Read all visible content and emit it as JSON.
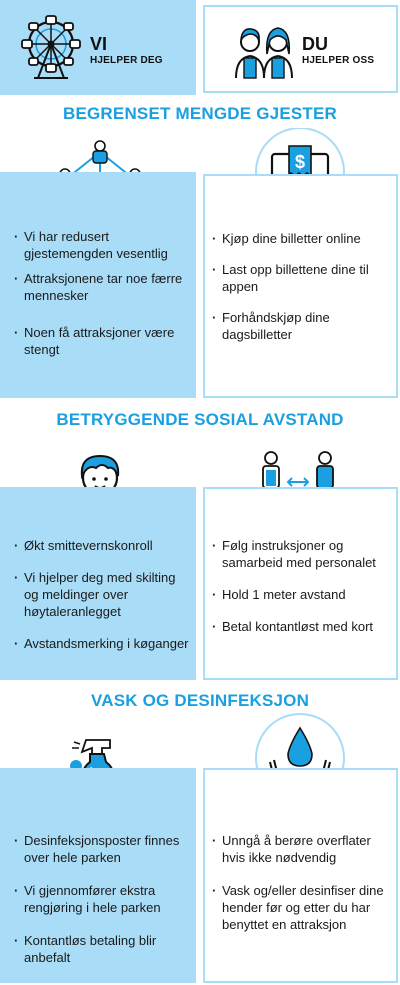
{
  "top": {
    "left": {
      "title": "VI",
      "subtitle": "HJELPER DEG"
    },
    "right": {
      "title": "DU",
      "subtitle": "HJELPER OSS"
    }
  },
  "sections": [
    {
      "header": "BEGRENSET MENGDE GJESTER",
      "left_items": [
        "Vi har redusert gjestemengden vesentlig",
        "Attraksjonene tar noe færre mennesker",
        "Noen få attraksjoner være stengt"
      ],
      "right_items": [
        "Kjøp dine billetter online",
        "Last opp billettene dine til appen",
        "Forhåndskjøp dine dagsbilletter"
      ]
    },
    {
      "header": "BETRYGGENDE SOSIAL AVSTAND",
      "left_items": [
        "Økt smittevernskonroll",
        "Vi hjelper deg med skilting og meldinger over høytaleranlegget",
        "Avstandsmerking i køganger"
      ],
      "right_items": [
        "Følg instruksjoner og samarbeid med personalet",
        "Hold 1 meter avstand",
        "Betal kontantløst med kort"
      ]
    },
    {
      "header": "VASK OG DESINFEKSJON",
      "left_items": [
        "Desinfeksjonsposter finnes over hele parken",
        "Vi gjennomfører ekstra rengjøring i hele parken",
        "Kontantløs betaling blir anbefalt"
      ],
      "right_items": [
        "Unngå å berøre overflater hvis ikke nødvendig",
        "Vask og/eller desinfiser dine hender før og etter du har benyttet en attraksjon"
      ]
    }
  ],
  "colors": {
    "accent": "#1aa0e0",
    "panel": "#a9dcf7",
    "ink": "#1a1a1a"
  },
  "icons": [
    "ferris-wheel-icon",
    "people-icon",
    "network-people-icon",
    "monitor-ticket-icon",
    "staff-boy-icon",
    "distance-people-icon",
    "spray-bottle-icon",
    "hands-drop-icon"
  ]
}
